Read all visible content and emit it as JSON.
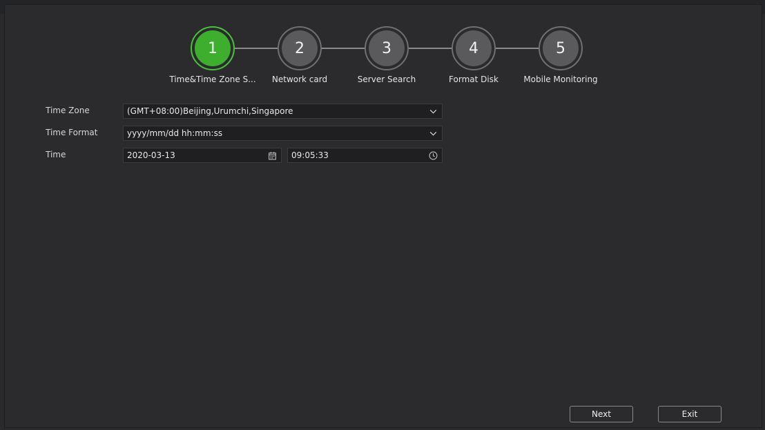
{
  "wizard": {
    "steps": [
      {
        "number": "1",
        "label": "Time&Time Zone S...",
        "active": true
      },
      {
        "number": "2",
        "label": "Network card",
        "active": false
      },
      {
        "number": "3",
        "label": "Server Search",
        "active": false
      },
      {
        "number": "4",
        "label": "Format Disk",
        "active": false
      },
      {
        "number": "5",
        "label": "Mobile Monitoring",
        "active": false
      }
    ]
  },
  "form": {
    "time_zone": {
      "label": "Time Zone",
      "value": "(GMT+08:00)Beijing,Urumchi,Singapore"
    },
    "time_format": {
      "label": "Time Format",
      "value": "yyyy/mm/dd hh:mm:ss"
    },
    "time": {
      "label": "Time",
      "date": "2020-03-13",
      "clock": "09:05:33"
    }
  },
  "buttons": {
    "next": "Next",
    "exit": "Exit"
  },
  "colors": {
    "active_step": "#3dae2e",
    "inactive_step": "#5a5a5c",
    "background": "#2b2b2e"
  },
  "icons": [
    "chevron-down-icon",
    "calendar-icon",
    "clock-icon"
  ]
}
